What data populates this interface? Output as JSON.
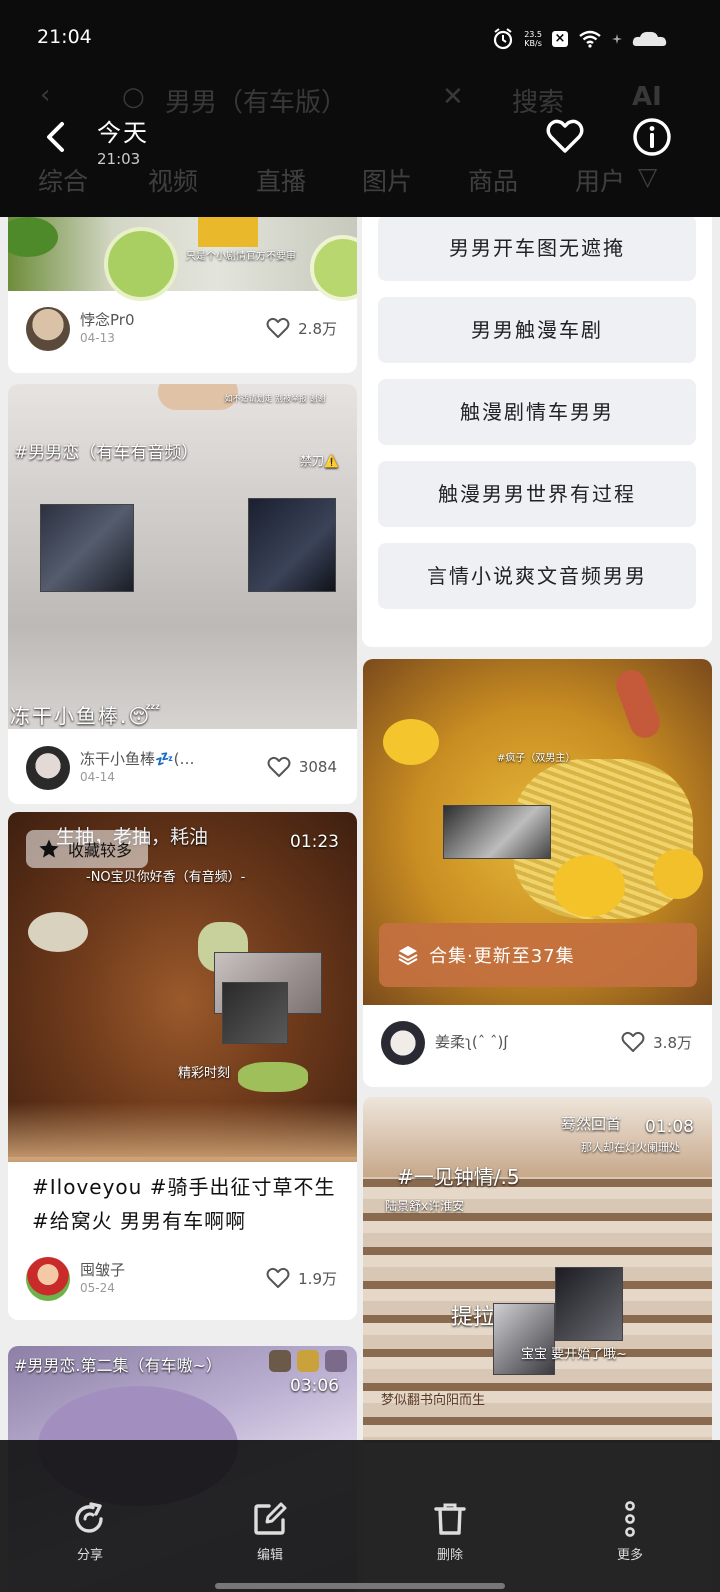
{
  "status": {
    "time": "21:04",
    "net_speed_value": "23.5",
    "net_speed_unit": "KB/s"
  },
  "ghost_search": {
    "query": "男男（有车版）",
    "search_label": "搜索",
    "ai_label": "AI",
    "tabs": [
      "综合",
      "视频",
      "直播",
      "图片",
      "商品",
      "用户"
    ]
  },
  "header": {
    "title": "今天",
    "subtitle": "21:03"
  },
  "feed": {
    "left": [
      {
        "overlay_text": "只是个小剧情官方不要审",
        "author": "悖念Pr0",
        "date": "04-13",
        "likes": "2.8万"
      },
      {
        "overlay_top": "#男男恋（有车有音频）",
        "overlay_warning": "禁刀⚠️",
        "overlay_small": "如不适请划走 别被举报 谢谢",
        "overlay_bottom": "冻干小鱼棒.😴",
        "author": "冻干小鱼棒💤(…",
        "date": "04-14",
        "likes": "3084"
      },
      {
        "badge": "收藏较多",
        "duration": "01:23",
        "overlay_top": "生抽，老抽，耗油",
        "overlay_sub": "-NO宝贝你好香（有音频）-",
        "overlay_mid": "精彩时刻",
        "title": "#Iloveyou #骑手出征寸草不生 #给窝火 男男有车啊啊",
        "author": "囤皱子",
        "date": "05-24",
        "likes": "1.9万"
      },
      {
        "overlay_top": "#男男恋.第二集（有车嗷~）",
        "duration": "03:06"
      }
    ],
    "right_tags": [
      "男男开车图无遮掩",
      "男男触漫车剧",
      "触漫剧情车男男",
      "触漫男男世界有过程",
      "言情小说爽文音频男男"
    ],
    "right": [
      {
        "overlay_label": "#疯子（双男主）",
        "series": "合集·更新至37集",
        "author": "姜柔ʅ(ˆ ˆ)ʃ",
        "likes": "3.8万"
      },
      {
        "duration": "01:08",
        "overlay_top": "蓦然回首",
        "overlay_top2": "那人却在灯火阑珊处",
        "overlay_title": "#一见钟情/.5",
        "overlay_sub": "陆景舒x许淮安",
        "overlay_mid": "提拉米苏",
        "overlay_sub2": "宝宝 要开始了哦~",
        "overlay_bottom": "梦似翻书向阳而生"
      }
    ]
  },
  "toolbar": {
    "share": "分享",
    "edit": "编辑",
    "delete": "删除",
    "more": "更多"
  },
  "colors": {
    "top_bg": "#0c0c0c",
    "feed_bg": "#eeeeee",
    "series_bar": "#c47040",
    "tag_chip_bg": "#eef0f4"
  }
}
